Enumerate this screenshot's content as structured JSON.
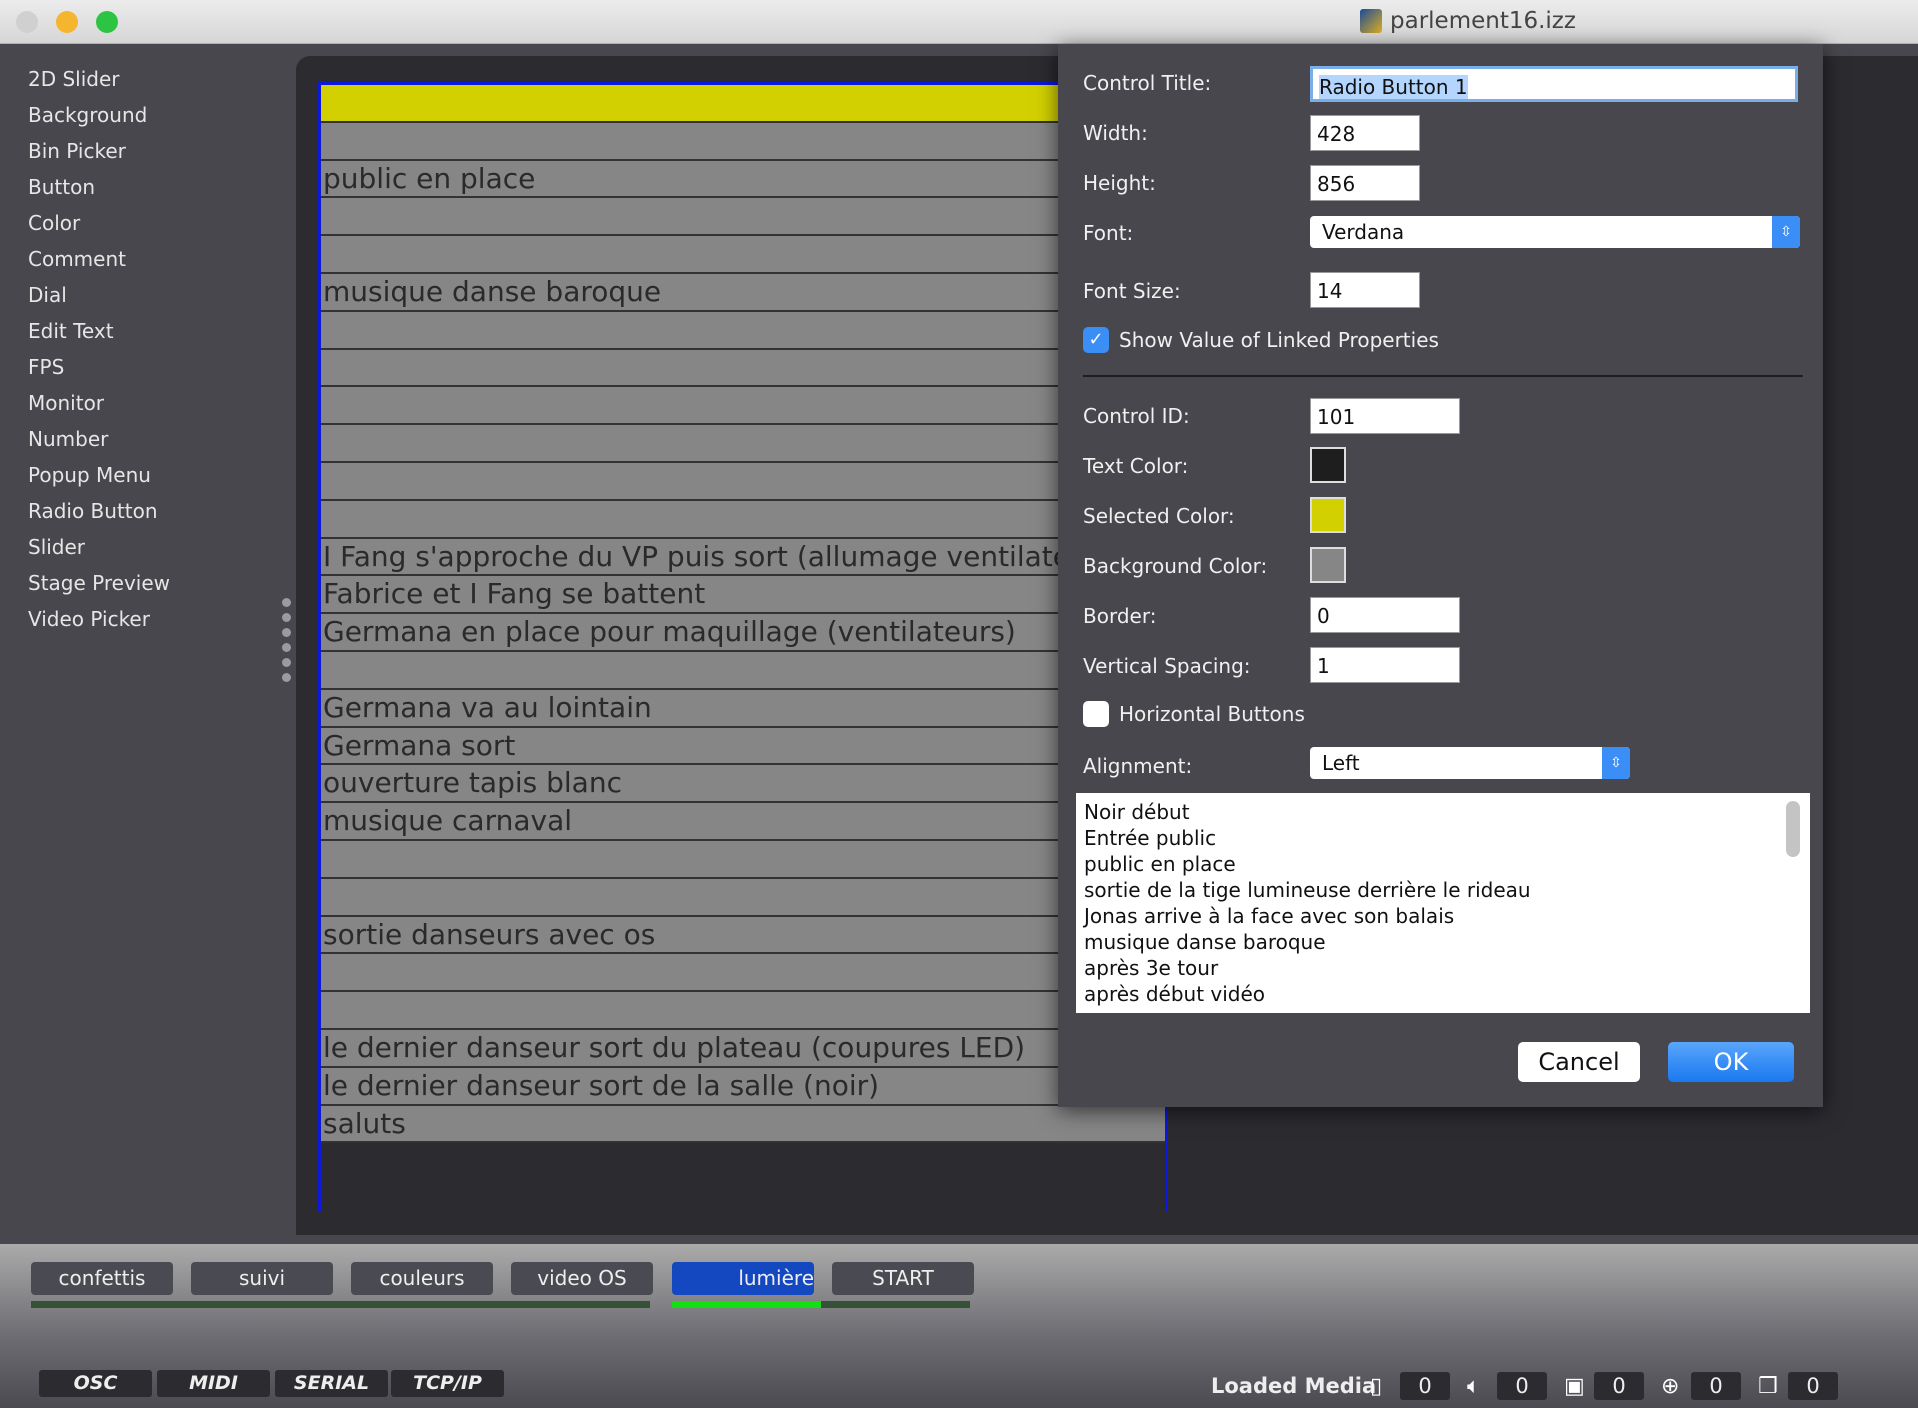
{
  "window": {
    "title": "parlement16.izz"
  },
  "sidebar": {
    "items": [
      "2D Slider",
      "Background",
      "Bin Picker",
      "Button",
      "Color",
      "Comment",
      "Dial",
      "Edit Text",
      "FPS",
      "Monitor",
      "Number",
      "Popup Menu",
      "Radio Button",
      "Slider",
      "Stage Preview",
      "Video Picker"
    ]
  },
  "radio": {
    "selected_index": 0,
    "selected_color": "#d2d000",
    "background_color": "#868686",
    "rows": [
      "",
      "",
      "public en place",
      "",
      "",
      "musique danse baroque",
      "",
      "",
      "",
      "",
      "",
      "",
      "I Fang s'approche du VP puis sort (allumage ventilateurs)",
      "Fabrice et I Fang se battent",
      "Germana en place pour maquillage (ventilateurs)",
      "",
      "Germana va au lointain",
      "Germana sort",
      "ouverture tapis blanc",
      "musique carnaval",
      "",
      "",
      "sortie danseurs avec os",
      "",
      "",
      "le dernier danseur sort du plateau (coupures LED)",
      "le dernier danseur sort de la salle (noir)",
      "saluts"
    ]
  },
  "dialog": {
    "control_title_label": "Control Title:",
    "control_title": "Radio Button 1",
    "width_label": "Width:",
    "width": "428",
    "height_label": "Height:",
    "height": "856",
    "font_label": "Font:",
    "font": "Verdana",
    "font_size_label": "Font Size:",
    "font_size": "14",
    "show_value_label": "Show Value of Linked Properties",
    "show_value": true,
    "control_id_label": "Control ID:",
    "control_id": "101",
    "text_color_label": "Text Color:",
    "text_color": "#1e1e1e",
    "selected_color_label": "Selected Color:",
    "selected_color": "#d2d000",
    "background_color_label": "Background Color:",
    "background_color": "#868686",
    "border_label": "Border:",
    "border": "0",
    "vertical_spacing_label": "Vertical Spacing:",
    "vertical_spacing": "1",
    "horizontal_buttons_label": "Horizontal Buttons",
    "horizontal_buttons": false,
    "alignment_label": "Alignment:",
    "alignment": "Left",
    "items": [
      "Noir début",
      "Entrée public",
      "public en place",
      "sortie de la tige lumineuse derrière le rideau",
      "Jonas arrive à la face avec son balais",
      "musique danse baroque",
      "après 3e tour",
      "après début vidéo"
    ],
    "cancel": "Cancel",
    "ok": "OK"
  },
  "cues": {
    "buttons": [
      "confettis",
      "suivi",
      "couleurs",
      "video OS",
      "lumière",
      "START"
    ],
    "active_index": 4,
    "progress": 0.5
  },
  "protocols": [
    "OSC",
    "MIDI",
    "SERIAL",
    "TCP/IP"
  ],
  "status": {
    "loaded_media_label": "Loaded Media",
    "counts": [
      {
        "icon": "film-icon",
        "value": "0"
      },
      {
        "icon": "speaker-icon",
        "value": "0"
      },
      {
        "icon": "picture-icon",
        "value": "0"
      },
      {
        "icon": "globe-icon",
        "value": "0"
      },
      {
        "icon": "cube-icon",
        "value": "0"
      }
    ]
  }
}
